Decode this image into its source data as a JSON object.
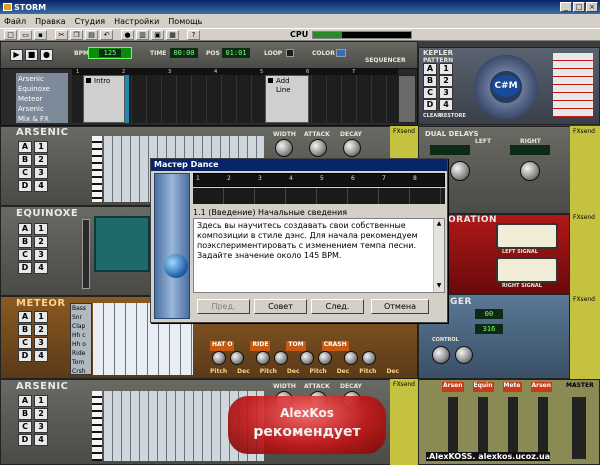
{
  "window": {
    "title": "STORM",
    "min": "_",
    "max": "□",
    "close": "×"
  },
  "menu": [
    "Файл",
    "Правка",
    "Студия",
    "Настройки",
    "Помощь"
  ],
  "toolbar": {
    "cpu_label": "CPU",
    "cpu_level": 0.3
  },
  "transport": {
    "bpm_label": "BPM",
    "bpm_value": "125",
    "time_label": "TIME",
    "time_value": "00:00",
    "pos_label": "POS",
    "pos_value": "01:01",
    "loop_label": "LOOP",
    "color_label": "COLOR",
    "sequencer_label": "SEQUENCER"
  },
  "tracks": {
    "names": [
      "Arsenic",
      "Equinoxe",
      "Meteor",
      "Arsenic",
      "Mix & FX"
    ],
    "patterns": [
      "Intro",
      "Add Line"
    ],
    "ruler": [
      "1",
      "2",
      "3",
      "4",
      "5",
      "6",
      "7"
    ]
  },
  "kepler": {
    "title": "KEPLER",
    "pattern_label": "PATTERN",
    "chord": "C#M",
    "clear_label": "CLEAR",
    "restore_label": "RESTORE"
  },
  "pattern_buttons": [
    "A",
    "B",
    "C",
    "D",
    "1",
    "2",
    "3",
    "4"
  ],
  "modules": {
    "arsenic": "ARSENIC",
    "equinoxe": "EQUINOXE",
    "meteor": "METEOR",
    "width": "WIDTH",
    "attack": "ATTACK",
    "decay": "DECAY",
    "fxsend": "FXsend",
    "dual_delays": "DUAL DELAYS",
    "left": "LEFT",
    "right": "RIGHT",
    "right_signal": "RIGHT SIGNAL",
    "left_signal": "LEFT SIGNAL",
    "oration": "ORATION",
    "ger": "GER",
    "control": "CONTROL",
    "master": "MASTER",
    "drums": [
      "Bass",
      "Snr",
      "Clap",
      "Hh c",
      "Hh o",
      "Ride",
      "Tom",
      "Crsh"
    ],
    "drum_groups": [
      "HAT O",
      "RIDE",
      "TOM",
      "CRASH"
    ],
    "pitch": "Pitch",
    "dec": "Dec",
    "mixer": [
      "Arsen",
      "Equin",
      "Mete",
      "Arsen"
    ],
    "meteor_lcd": "00",
    "meteor_lcd2": "316"
  },
  "dialog": {
    "title": "Мастер Dance",
    "ruler": [
      "1",
      "2",
      "3",
      "4",
      "5",
      "6",
      "7",
      "8"
    ],
    "heading": "1.1 (Введение) Начальные сведения",
    "body": "Здесь вы научитесь создавать свои собственные композиции в стиле дэнс. Для начала рекомендуем поэкспериментировать с изменением темпа песни. Задайте значение около 145 BPM.",
    "buttons": {
      "prev": "Пред.",
      "hint": "Совет",
      "next": "След.",
      "cancel": "Отмена"
    }
  },
  "watermark": {
    "line1": "AlexKos",
    "line2": "рекомендует"
  },
  "credit": ".AlexKOSS. alexkos.ucoz.ua"
}
